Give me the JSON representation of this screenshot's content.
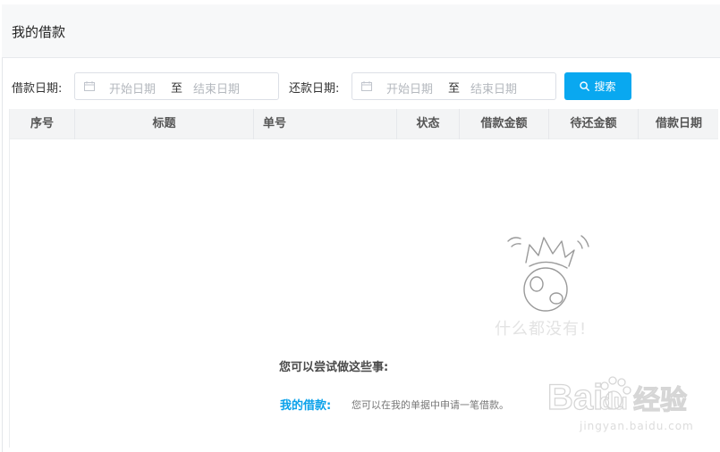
{
  "header": {
    "title": "我的借款"
  },
  "filters": {
    "borrow_date_label": "借款日期:",
    "repay_date_label": "还款日期:",
    "start_placeholder": "开始日期",
    "end_placeholder": "结束日期",
    "range_separator": "至",
    "search_label": "搜索"
  },
  "table": {
    "columns": [
      "序号",
      "标题",
      "单号",
      "状态",
      "借款金额",
      "待还金额",
      "借款日期"
    ]
  },
  "empty_state": {
    "message": "什么都没有!",
    "suggest_heading": "您可以尝试做这些事:",
    "action_label": "我的借款:",
    "action_desc": "您可以在我的单据中申请一笔借款。"
  },
  "watermark": {
    "brand_left": "Bai",
    "brand_right": "du",
    "brand_suffix": "经验",
    "url": "jingyan.baidu.com"
  },
  "colors": {
    "accent": "#09a8f0",
    "link": "#0aa1ea",
    "header_bg": "#f7f8f9",
    "table_head_bg": "#f3f4f5"
  },
  "icons": {
    "date": "calendar-icon",
    "search": "search-icon",
    "empty": "empty-box-illustration",
    "paw": "paw-icon"
  }
}
